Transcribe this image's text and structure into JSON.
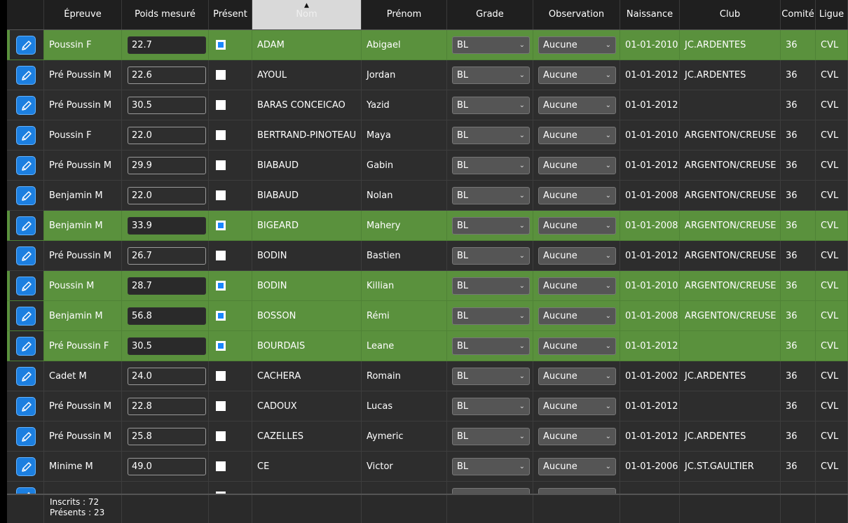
{
  "columns": {
    "epreuve": "Épreuve",
    "poids": "Poids mesuré",
    "present": "Présent",
    "nom": "Nom",
    "prenom": "Prénom",
    "grade": "Grade",
    "observation": "Observation",
    "naissance": "Naissance",
    "club": "Club",
    "comite": "Comité",
    "ligue": "Ligue"
  },
  "sort": {
    "column": "nom",
    "direction": "ascending",
    "arrow": "▲"
  },
  "rows": [
    {
      "epreuve": "Poussin F",
      "poids": "22.7",
      "present": true,
      "nom": "ADAM",
      "prenom": "Abigael",
      "grade": "BL",
      "observation": "Aucune",
      "naissance": "01-01-2010",
      "club": "JC.ARDENTES",
      "comite": "36",
      "ligue": "CVL"
    },
    {
      "epreuve": "Pré Poussin M",
      "poids": "22.6",
      "present": false,
      "nom": "AYOUL",
      "prenom": "Jordan",
      "grade": "BL",
      "observation": "Aucune",
      "naissance": "01-01-2012",
      "club": "JC.ARDENTES",
      "comite": "36",
      "ligue": "CVL"
    },
    {
      "epreuve": "Pré Poussin M",
      "poids": "30.5",
      "present": false,
      "nom": "BARAS CONCEICAO",
      "prenom": "Yazid",
      "grade": "BL",
      "observation": "Aucune",
      "naissance": "01-01-2012",
      "club": "",
      "comite": "36",
      "ligue": "CVL"
    },
    {
      "epreuve": "Poussin F",
      "poids": "22.0",
      "present": false,
      "nom": "BERTRAND-PINOTEAU",
      "prenom": "Maya",
      "grade": "BL",
      "observation": "Aucune",
      "naissance": "01-01-2010",
      "club": "ARGENTON/CREUSE",
      "comite": "36",
      "ligue": "CVL"
    },
    {
      "epreuve": "Pré Poussin M",
      "poids": "29.9",
      "present": false,
      "nom": "BIABAUD",
      "prenom": "Gabin",
      "grade": "BL",
      "observation": "Aucune",
      "naissance": "01-01-2012",
      "club": "ARGENTON/CREUSE",
      "comite": "36",
      "ligue": "CVL"
    },
    {
      "epreuve": "Benjamin M",
      "poids": "22.0",
      "present": false,
      "nom": "BIABAUD",
      "prenom": "Nolan",
      "grade": "BL",
      "observation": "Aucune",
      "naissance": "01-01-2008",
      "club": "ARGENTON/CREUSE",
      "comite": "36",
      "ligue": "CVL"
    },
    {
      "epreuve": "Benjamin M",
      "poids": "33.9",
      "present": true,
      "nom": "BIGEARD",
      "prenom": "Mahery",
      "grade": "BL",
      "observation": "Aucune",
      "naissance": "01-01-2008",
      "club": "ARGENTON/CREUSE",
      "comite": "36",
      "ligue": "CVL"
    },
    {
      "epreuve": "Pré Poussin M",
      "poids": "26.7",
      "present": false,
      "nom": "BODIN",
      "prenom": "Bastien",
      "grade": "BL",
      "observation": "Aucune",
      "naissance": "01-01-2012",
      "club": "ARGENTON/CREUSE",
      "comite": "36",
      "ligue": "CVL"
    },
    {
      "epreuve": "Poussin M",
      "poids": "28.7",
      "present": true,
      "nom": "BODIN",
      "prenom": "Killian",
      "grade": "BL",
      "observation": "Aucune",
      "naissance": "01-01-2010",
      "club": "ARGENTON/CREUSE",
      "comite": "36",
      "ligue": "CVL"
    },
    {
      "epreuve": "Benjamin M",
      "poids": "56.8",
      "present": true,
      "nom": "BOSSON",
      "prenom": "Rémi",
      "grade": "BL",
      "observation": "Aucune",
      "naissance": "01-01-2008",
      "club": "ARGENTON/CREUSE",
      "comite": "36",
      "ligue": "CVL"
    },
    {
      "epreuve": "Pré Poussin F",
      "poids": "30.5",
      "present": true,
      "nom": "BOURDAIS",
      "prenom": "Leane",
      "grade": "BL",
      "observation": "Aucune",
      "naissance": "01-01-2012",
      "club": "",
      "comite": "36",
      "ligue": "CVL"
    },
    {
      "epreuve": "Cadet M",
      "poids": "24.0",
      "present": false,
      "nom": "CACHERA",
      "prenom": "Romain",
      "grade": "BL",
      "observation": "Aucune",
      "naissance": "01-01-2002",
      "club": "JC.ARDENTES",
      "comite": "36",
      "ligue": "CVL"
    },
    {
      "epreuve": "Pré Poussin M",
      "poids": "22.8",
      "present": false,
      "nom": "CADOUX",
      "prenom": "Lucas",
      "grade": "BL",
      "observation": "Aucune",
      "naissance": "01-01-2012",
      "club": "",
      "comite": "36",
      "ligue": "CVL"
    },
    {
      "epreuve": "Pré Poussin M",
      "poids": "25.8",
      "present": false,
      "nom": "CAZELLES",
      "prenom": "Aymeric",
      "grade": "BL",
      "observation": "Aucune",
      "naissance": "01-01-2012",
      "club": "JC.ARDENTES",
      "comite": "36",
      "ligue": "CVL"
    },
    {
      "epreuve": "Minime M",
      "poids": "49.0",
      "present": false,
      "nom": "CE",
      "prenom": "Victor",
      "grade": "BL",
      "observation": "Aucune",
      "naissance": "01-01-2006",
      "club": "JC.ST.GAULTIER",
      "comite": "36",
      "ligue": "CVL"
    },
    {
      "epreuve": "",
      "poids": "",
      "present": false,
      "nom": "",
      "prenom": "",
      "grade": "",
      "observation": "",
      "naissance": "",
      "club": "",
      "comite": "",
      "ligue": ""
    }
  ],
  "footer": {
    "inscrits": "Inscrits : 72",
    "presents": "Présents : 23"
  },
  "icons": {
    "edit": "pencil-icon",
    "dropdown": "chevron-down-icon"
  },
  "colors": {
    "present_row": "#5a913d",
    "edit_button": "#1c7fe0",
    "checkbox_on": "#1a87ff"
  }
}
